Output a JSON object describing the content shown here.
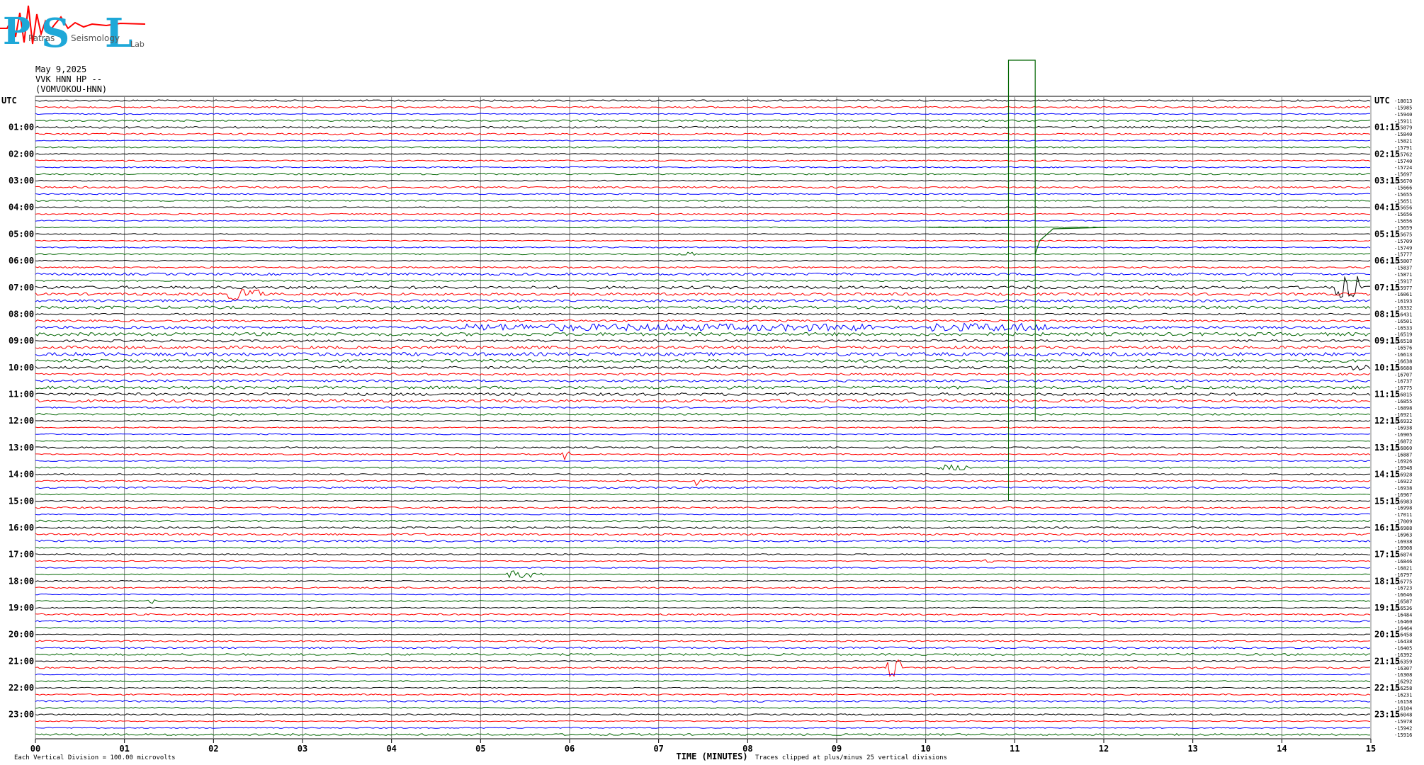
{
  "logo": {
    "letters": [
      "P",
      "S",
      "L"
    ],
    "words": [
      "Patras",
      "Seismology",
      "Lab"
    ]
  },
  "header": {
    "date": "May 9,2025",
    "station": "VVK HNN HP --",
    "site": "(VOMVOKOU-HNN)"
  },
  "footer": {
    "scale_note": "Each Vertical Division =  100.00 microvolts",
    "clip_note": "Traces clipped at plus/minus 25 vertical divisions"
  },
  "colors": {
    "trace_cycle": [
      "#000000",
      "#ff0000",
      "#0000ff",
      "#006400"
    ],
    "grid": "#808080",
    "frame": "#000000",
    "logo_letters": "#1ea8d8",
    "logo_wave": "#ff0000"
  },
  "chart_data": {
    "type": "line",
    "title": "May 9,2025  VVK HNN HP --  (VOMVOKOU-HNN)",
    "xlabel": "TIME (MINUTES)",
    "ylabel": "UTC",
    "xlim": [
      0,
      15
    ],
    "x_ticks": [
      "00",
      "01",
      "02",
      "03",
      "04",
      "05",
      "06",
      "07",
      "08",
      "09",
      "10",
      "11",
      "12",
      "13",
      "14",
      "15"
    ],
    "left_hour_labels": [
      "UTC",
      "01:00",
      "02:00",
      "03:00",
      "04:00",
      "05:00",
      "06:00",
      "07:00",
      "08:00",
      "09:00",
      "10:00",
      "11:00",
      "12:00",
      "13:00",
      "14:00",
      "15:00",
      "16:00",
      "17:00",
      "18:00",
      "19:00",
      "20:00",
      "21:00",
      "22:00",
      "23:00"
    ],
    "right_hour_labels": [
      "UTC",
      "01:15",
      "02:15",
      "03:15",
      "04:15",
      "05:15",
      "06:15",
      "07:15",
      "08:15",
      "09:15",
      "10:15",
      "11:15",
      "12:15",
      "13:15",
      "14:15",
      "15:15",
      "16:15",
      "17:15",
      "18:15",
      "19:15",
      "20:15",
      "21:15",
      "22:15",
      "23:15"
    ],
    "trace_minutes": 15,
    "trace_count": 96,
    "trace_means": [
      "-18013",
      "-15985",
      "-15940",
      "-15911",
      "-15879",
      "-15840",
      "-15821",
      "-15791",
      "-15762",
      "-15740",
      "-15724",
      "-15697",
      "-15670",
      "-15666",
      "-15655",
      "-15651",
      "-15656",
      "-15656",
      "-15656",
      "-15659",
      "-15675",
      "-15709",
      "-15749",
      "-15777",
      "-15807",
      "-15837",
      "-15871",
      "-15917",
      "-15977",
      "-16061",
      "-16193",
      "-16332",
      "-16431",
      "-16501",
      "-16533",
      "-16519",
      "-16518",
      "-16576",
      "-16613",
      "-16638",
      "-16688",
      "-16707",
      "-16737",
      "-16775",
      "-16815",
      "-16855",
      "-16898",
      "-16921",
      "-16932",
      "-16938",
      "-16905",
      "-16872",
      "-16860",
      "-16887",
      "-16926",
      "-16948",
      "-16928",
      "-16922",
      "-16938",
      "-16967",
      "-16983",
      "-16998",
      "-17011",
      "-17009",
      "-16988",
      "-16963",
      "-16938",
      "-16908",
      "-16874",
      "-16846",
      "-16821",
      "-16797",
      "-16775",
      "-16723",
      "-16646",
      "-16587",
      "-16536",
      "-16484",
      "-16460",
      "-16464",
      "-16458",
      "-16438",
      "-16405",
      "-16392",
      "-16359",
      "-16307",
      "-16308",
      "-16292",
      "-16258",
      "-16231",
      "-16158",
      "-16104",
      "-16048",
      "-15978",
      "-15942",
      "-15916"
    ],
    "vertical_division_microvolts": 100.0,
    "clip_divisions": 25,
    "events": [
      {
        "trace": 29,
        "minute": 2.35,
        "amplitude": 8,
        "duration_min": 0.35,
        "note": "burst"
      },
      {
        "trace": 28,
        "minute": 14.75,
        "amplitude": 16,
        "duration_min": 0.25,
        "note": "burst"
      },
      {
        "trace": 34,
        "minute": 7.1,
        "amplitude": 5,
        "duration_min": 4.6,
        "note": "noise band"
      },
      {
        "trace": 34,
        "minute": 10.7,
        "amplitude": 6,
        "duration_min": 1.3,
        "note": "noise band"
      },
      {
        "trace": 23,
        "minute": 7.3,
        "amplitude": 4,
        "duration_min": 0.15,
        "note": "spike"
      },
      {
        "trace": 53,
        "minute": 5.95,
        "amplitude": 8,
        "duration_min": 0.03,
        "note": "spike"
      },
      {
        "trace": 57,
        "minute": 7.45,
        "amplitude": 7,
        "duration_min": 0.05,
        "note": "spike"
      },
      {
        "trace": 55,
        "minute": 10.3,
        "amplitude": 4,
        "duration_min": 0.3,
        "note": "burst"
      },
      {
        "trace": 71,
        "minute": 5.5,
        "amplitude": 5,
        "duration_min": 0.35,
        "note": "burst"
      },
      {
        "trace": 69,
        "minute": 10.7,
        "amplitude": 4,
        "duration_min": 0.04,
        "note": "spike"
      },
      {
        "trace": 85,
        "minute": 9.65,
        "amplitude": 12,
        "duration_min": 0.12,
        "note": "burst"
      },
      {
        "trace": 75,
        "minute": 1.3,
        "amplitude": 4,
        "duration_min": 0.03,
        "note": "spike"
      },
      {
        "trace": 40,
        "minute": 14.9,
        "amplitude": 4,
        "duration_min": 0.2,
        "note": "burst"
      }
    ],
    "clipped_excursion": {
      "from_trace": 16,
      "to_trace": 20,
      "minute_start": 10.93,
      "minute_end": 11.23,
      "clip_top_minute_start": 10.93,
      "clip_top_minute_end": 11.23
    },
    "grid": true
  }
}
